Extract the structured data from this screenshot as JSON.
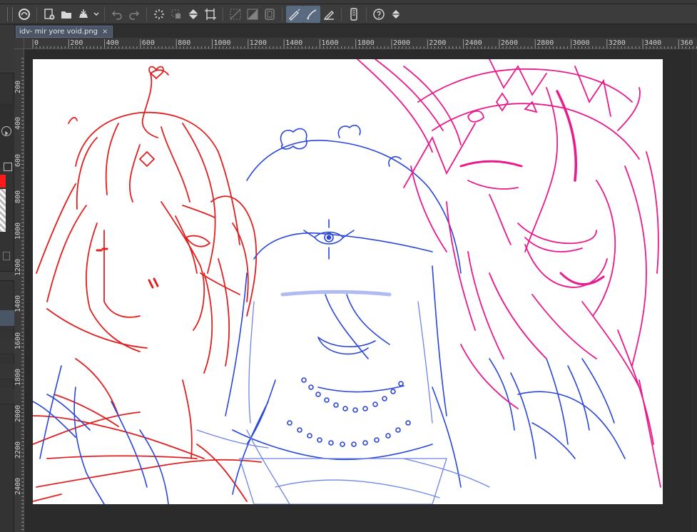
{
  "document": {
    "tab_title": "idv- mir yore void.png",
    "close_glyph": "×"
  },
  "toolbar": {
    "buttons": [
      {
        "name": "app-logo-icon"
      },
      {
        "name": "new-canvas-icon"
      },
      {
        "name": "open-folder-icon"
      },
      {
        "name": "save-icon"
      },
      {
        "name": "undo-icon"
      },
      {
        "name": "redo-icon"
      },
      {
        "name": "loading-icon"
      },
      {
        "name": "deselect-icon"
      },
      {
        "name": "fill-icon"
      },
      {
        "name": "transform-icon"
      },
      {
        "name": "grid-off-icon"
      },
      {
        "name": "tone-icon"
      },
      {
        "name": "frame-icon"
      },
      {
        "name": "pen-active-icon"
      },
      {
        "name": "brush-active-icon"
      },
      {
        "name": "eraser-pen-icon"
      },
      {
        "name": "device-icon"
      },
      {
        "name": "help-icon"
      },
      {
        "name": "color-fill-icon"
      }
    ]
  },
  "ruler": {
    "horizontal": [
      "0",
      "200",
      "400",
      "600",
      "800",
      "1000",
      "1200",
      "1400",
      "1600",
      "1800",
      "2000",
      "2200",
      "2400",
      "2600",
      "2800",
      "3000",
      "3200",
      "3400",
      "360"
    ],
    "vertical": [
      "200",
      "400",
      "600",
      "800",
      "1000",
      "1200",
      "1400",
      "1600",
      "1800",
      "2000",
      "2200",
      "2400"
    ]
  },
  "colors": {
    "accent": "#5a6a80",
    "sketch_red": "#e02020",
    "sketch_blue": "#2a45d8",
    "sketch_blue_light": "#6f84e6",
    "sketch_pink": "#e81a8c"
  }
}
